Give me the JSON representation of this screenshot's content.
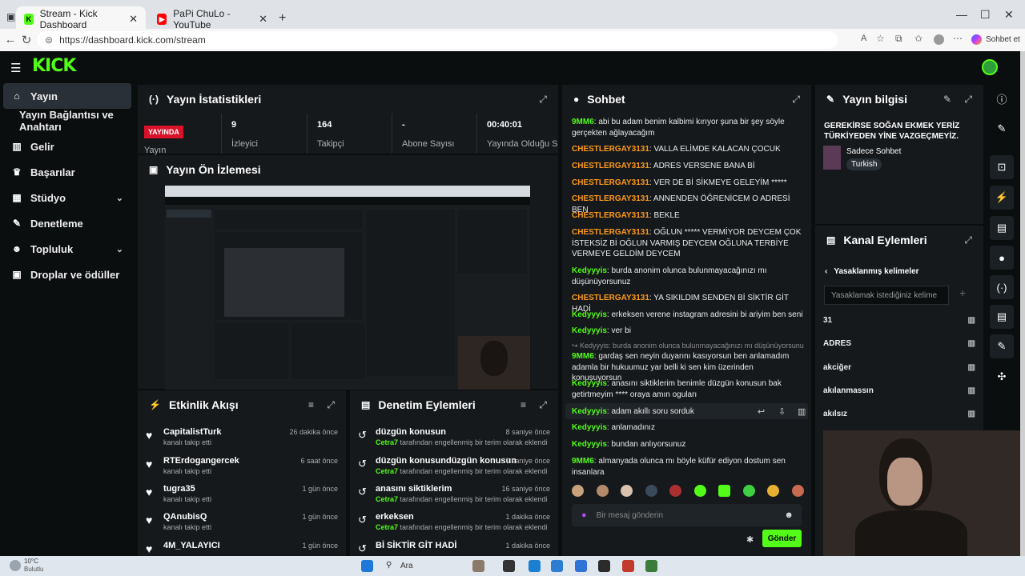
{
  "browser": {
    "tabs": [
      {
        "title": "Stream - Kick Dashboard",
        "active": true
      },
      {
        "title": "PaPi ChuLo - YouTube",
        "active": false
      }
    ],
    "url": "https://dashboard.kick.com/stream",
    "profile_label": "Sohbet et"
  },
  "app": {
    "logo": "KICK",
    "sidebar": [
      {
        "label": "Yayın",
        "icon": "home-icon",
        "selected": true
      },
      {
        "label": "Yayın Bağlantısı ve Anahtarı",
        "icon": "",
        "selected": false
      },
      {
        "label": "Gelir",
        "icon": "chart-icon",
        "selected": false
      },
      {
        "label": "Başarılar",
        "icon": "trophy-icon",
        "selected": false
      },
      {
        "label": "Stüdyo",
        "icon": "film-icon",
        "selected": false,
        "expand": true
      },
      {
        "label": "Denetleme",
        "icon": "wrench-icon",
        "selected": false
      },
      {
        "label": "Topluluk",
        "icon": "users-icon",
        "selected": false,
        "expand": true
      },
      {
        "label": "Droplar ve ödüller",
        "icon": "gift-icon",
        "selected": false
      }
    ],
    "stats_panel": {
      "title": "Yayın İstatistikleri",
      "live_badge": "YAYINDA",
      "live_label": "Yayın",
      "stats": [
        {
          "value": "9",
          "label": "İzleyici"
        },
        {
          "value": "164",
          "label": "Takipçi"
        },
        {
          "value": "-",
          "label": "Abone Sayısı"
        },
        {
          "value": "00:40:01",
          "label": "Yayında Olduğu Süre"
        }
      ]
    },
    "preview_panel": {
      "title": "Yayın Ön İzlemesi"
    },
    "activity_panel": {
      "title": "Etkinlik Akışı",
      "items": [
        {
          "name": "CapitalistTurk",
          "sub": "kanalı takip etti",
          "time": "26 dakika önce"
        },
        {
          "name": "RTErdogangercek",
          "sub": "kanalı takip etti",
          "time": "6 saat önce"
        },
        {
          "name": "tugra35",
          "sub": "kanalı takip etti",
          "time": "1 gün önce"
        },
        {
          "name": "QAnubisQ",
          "sub": "kanalı takip etti",
          "time": "1 gün önce"
        },
        {
          "name": "4M_YALAYICI",
          "sub": "",
          "time": "1 gün önce"
        }
      ]
    },
    "mod_panel": {
      "title": "Denetim Eylemleri",
      "items": [
        {
          "word": "düzgün konusun",
          "by": "Cetra7",
          "text": "tarafından engellenmiş bir terim olarak eklendi",
          "time": "8 saniye önce"
        },
        {
          "word": "düzgün konusundüzgün konusun",
          "by": "Cetra7",
          "text": "tarafından engellenmiş bir terim olarak eklendi",
          "time": "10 saniye önce"
        },
        {
          "word": "anasını siktiklerim",
          "by": "Cetra7",
          "text": "tarafından engellenmiş bir terim olarak eklendi",
          "time": "16 saniye önce"
        },
        {
          "word": "erkeksen",
          "by": "Cetra7",
          "text": "tarafından engellenmiş bir terim olarak eklendi",
          "time": "1 dakika önce"
        },
        {
          "word": "Bİ SİKTİR GİT HADİ",
          "by": "",
          "text": "",
          "time": "1 dakika önce"
        }
      ]
    },
    "chat_panel": {
      "title": "Sohbet",
      "messages": [
        {
          "user": "9MM6",
          "color": "green",
          "text": "abi bu adam benim kalbimi kırıyor şuna bir şey söyle gerçekten ağlayacağım"
        },
        {
          "user": "CHESTLERGAY3131",
          "color": "orange",
          "text": "VALLA ELİMDE KALACAN ÇOCUK"
        },
        {
          "user": "CHESTLERGAY3131",
          "color": "orange",
          "text": "ADRES VERSENE BANA Bİ"
        },
        {
          "user": "CHESTLERGAY3131",
          "color": "orange",
          "text": "VER DE Bİ SİKMEYE GELEYİM *****"
        },
        {
          "user": "CHESTLERGAY3131",
          "color": "orange",
          "text": "ANNENDEN ÖĞRENİCEM O ADRESİ BEN"
        },
        {
          "user": "CHESTLERGAY3131",
          "color": "orange",
          "text": "BEKLE"
        },
        {
          "user": "CHESTLERGAY3131",
          "color": "orange",
          "text": "OĞLUN ***** VERMİYOR DEYCEM ÇOK İSTEKSİZ Bİ OĞLUN VARMIŞ DEYCEM OĞLUNA TERBİYE VERMEYE GELDİM DEYCEM"
        },
        {
          "user": "Kedyyyis",
          "color": "green",
          "text": "burda anonim olunca bulunmayacağınızı mı düşünüyorsunuz"
        },
        {
          "user": "CHESTLERGAY3131",
          "color": "orange",
          "text": "YA SIKILDIM SENDEN Bİ SİKTİR GİT HADİ"
        },
        {
          "user": "Kedyyyis",
          "color": "green",
          "text": "erkeksen verene instagram adresini bi ariyim ben seni"
        },
        {
          "user": "Kedyyyis",
          "color": "green",
          "text": "ver bi"
        },
        {
          "user": "9MM6",
          "color": "green",
          "text": "gardaş sen neyin duyarını kasıyorsun ben anlamadım adamla bir hukuumuz yar belli ki sen kim üzerinden konuşuyorsun",
          "reply": "Kedyyyis: burda anonim olunca bulunmayacağınızı mı düşünüyorsunu..."
        },
        {
          "user": "Kedyyyis",
          "color": "green",
          "text": "anasını siktiklerim benimle düzgün konusun bak getirtmeyim **** oraya amın oguları"
        },
        {
          "user": "Kedyyyis",
          "color": "green",
          "text": "adam akıllı soru sorduk"
        },
        {
          "user": "Kedyyyis",
          "color": "green",
          "text": "anlamadınız"
        },
        {
          "user": "Kedyyyis",
          "color": "green",
          "text": "bundan anlıyorsunuz"
        },
        {
          "user": "9MM6",
          "color": "green",
          "text": "almanyada olunca mı böyle küfür ediyon dostum sen insanlara"
        }
      ],
      "input_placeholder": "Bir mesaj gönderin",
      "send_label": "Gönder"
    },
    "info_panel": {
      "title": "Yayın bilgisi",
      "stream_title": "GEREKİRSE SOĞAN EKMEK YERİZ TÜRKİYEDEN YİNE VAZGEÇMEYİZ.",
      "category": "Sadece Sohbet",
      "tag": "Turkish"
    },
    "channel_actions": {
      "title": "Kanal Eylemleri",
      "sub_title": "Yasaklanmış kelimeler",
      "input_placeholder": "Yasaklamak istediğiniz kelime",
      "words": [
        "31",
        "ADRES",
        "akciğer",
        "akılanmassın",
        "akılsız"
      ]
    }
  },
  "taskbar": {
    "weather": "10°C",
    "weather_sub": "Bulutlu",
    "search": "Ara"
  },
  "colors": {
    "accent": "#53fc18",
    "orange": "#ff9a1a",
    "live": "#d9122a",
    "panel": "#15191c"
  }
}
